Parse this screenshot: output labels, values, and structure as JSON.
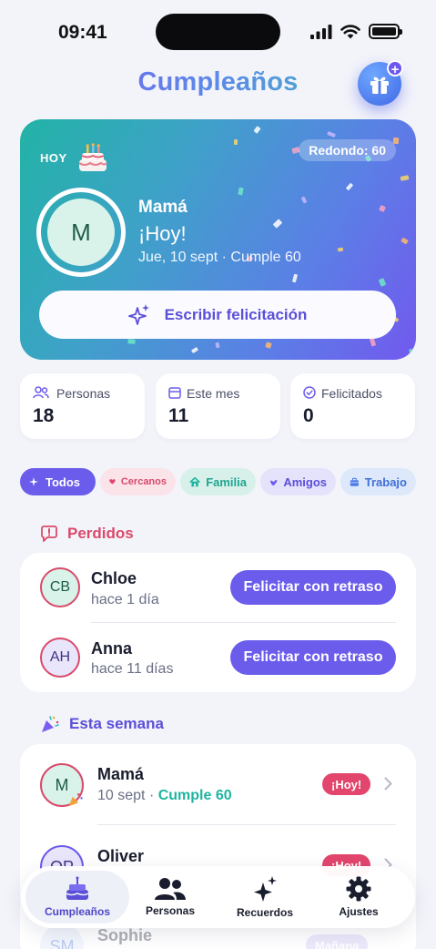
{
  "status_bar": {
    "time": "09:41"
  },
  "header": {
    "title": "Cumpleaños"
  },
  "hero": {
    "today_label": "HOY",
    "round_badge": "Redondo: 60",
    "avatar_initial": "M",
    "name": "Mamá",
    "status": "¡Hoy!",
    "date_line": "Jue, 10 sept · Cumple 60",
    "write_button": "Escribir felicitación"
  },
  "stats": [
    {
      "label": "Personas",
      "value": "18",
      "icon": "people-icon"
    },
    {
      "label": "Este mes",
      "value": "11",
      "icon": "calendar-icon"
    },
    {
      "label": "Felicitados",
      "value": "0",
      "icon": "check-circle-icon"
    }
  ],
  "filters": [
    {
      "label": "Todos",
      "icon": "sparkle-icon",
      "active": true
    },
    {
      "label": "Cercanos",
      "icon": "heart-icon"
    },
    {
      "label": "Familia",
      "icon": "home-icon"
    },
    {
      "label": "Amigos",
      "icon": "hands-icon"
    },
    {
      "label": "Trabajo",
      "icon": "briefcase-icon"
    }
  ],
  "missed": {
    "title": "Perdidos",
    "items": [
      {
        "initials": "CB",
        "name": "Chloe",
        "sub": "hace 1 día",
        "action": "Felicitar con retraso"
      },
      {
        "initials": "AH",
        "name": "Anna",
        "sub": "hace 11 días",
        "action": "Felicitar con retraso"
      }
    ]
  },
  "this_week": {
    "title": "Esta semana",
    "items": [
      {
        "initials": "M",
        "name": "Mamá",
        "date": "10 sept",
        "sep": "·",
        "turns": "Cumple 60",
        "badge": "¡Hoy!"
      },
      {
        "initials": "OP",
        "name": "Oliver",
        "date": "",
        "turns": "",
        "badge": "¡Hoy!"
      },
      {
        "initials": "SM",
        "name": "Sophie",
        "date": "",
        "turns": "",
        "badge": "Mañana"
      }
    ]
  },
  "tabs": [
    {
      "label": "Cumpleaños",
      "icon": "cake-icon",
      "active": true
    },
    {
      "label": "Personas",
      "icon": "people-icon"
    },
    {
      "label": "Recuerdos",
      "icon": "sparkles-icon"
    },
    {
      "label": "Ajustes",
      "icon": "gear-icon"
    }
  ],
  "colors": {
    "accent": "#6b5cec",
    "missed_red": "#d94a6a",
    "teal": "#1fb4a0",
    "today_badge": "#e2466d"
  }
}
